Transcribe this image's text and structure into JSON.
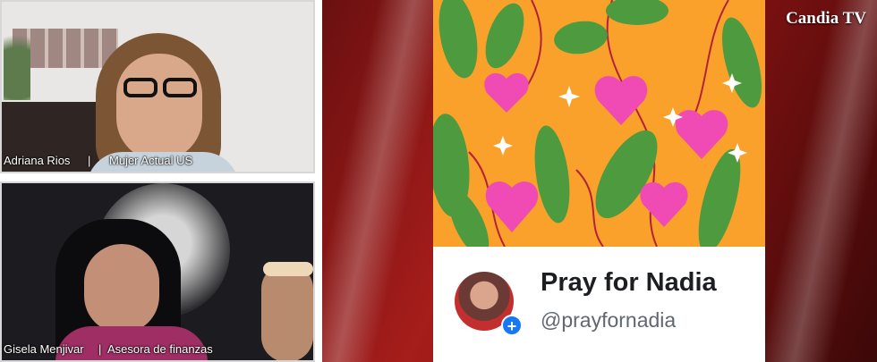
{
  "participants": [
    {
      "name": "Adriana Rios",
      "separator": "|",
      "org": "Mujer Actual US"
    },
    {
      "name": "Gisela Menjivar",
      "separator": "|",
      "org": "Asesora de finanzas"
    }
  ],
  "shared_screen": {
    "brand": "Candia TV",
    "page_name": "Pray for Nadia",
    "page_handle": "@prayfornadia",
    "add_badge": "+",
    "colors": {
      "banner": "#f9a12a",
      "leaf": "#4e9a3f",
      "heart": "#f04ab5",
      "stem": "#b3213a",
      "badge": "#1877f2"
    }
  },
  "icons": [
    "add-icon",
    "lion-background",
    "avatar"
  ]
}
